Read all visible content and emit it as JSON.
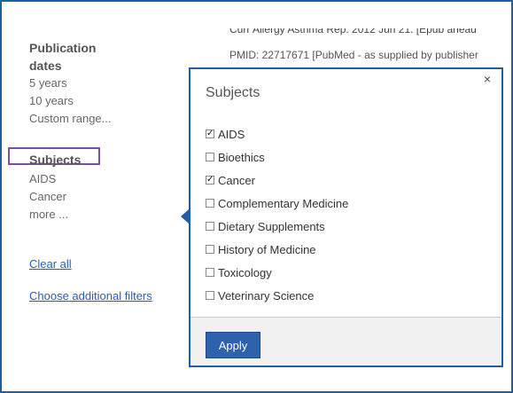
{
  "sidebar": {
    "pub_heading_1": "Publication",
    "pub_heading_2": "dates",
    "pub_items": [
      "5 years",
      "10 years",
      "Custom range..."
    ],
    "subjects_heading": "Subjects",
    "subject_items": [
      "AIDS",
      "Cancer",
      "more ..."
    ],
    "clear_all": "Clear all",
    "choose_filters": "Choose additional filters"
  },
  "background": {
    "line1": "Curr Allergy Asthma Rep. 2012 Jun 21. [Epub ahead",
    "line2": "PMID: 22717671 [PubMed - as supplied by publisher"
  },
  "popup": {
    "title": "Subjects",
    "close_glyph": "×",
    "options": [
      {
        "label": "AIDS",
        "checked": true
      },
      {
        "label": "Bioethics",
        "checked": false
      },
      {
        "label": "Cancer",
        "checked": true
      },
      {
        "label": "Complementary Medicine",
        "checked": false
      },
      {
        "label": "Dietary Supplements",
        "checked": false
      },
      {
        "label": "History of Medicine",
        "checked": false
      },
      {
        "label": "Toxicology",
        "checked": false
      },
      {
        "label": "Veterinary Science",
        "checked": false
      }
    ],
    "apply_label": "Apply"
  },
  "colors": {
    "frame": "#1f5fa8",
    "link": "#2a5db0",
    "highlight": "#7a4fa0",
    "apply_bg": "#2f62ad"
  }
}
